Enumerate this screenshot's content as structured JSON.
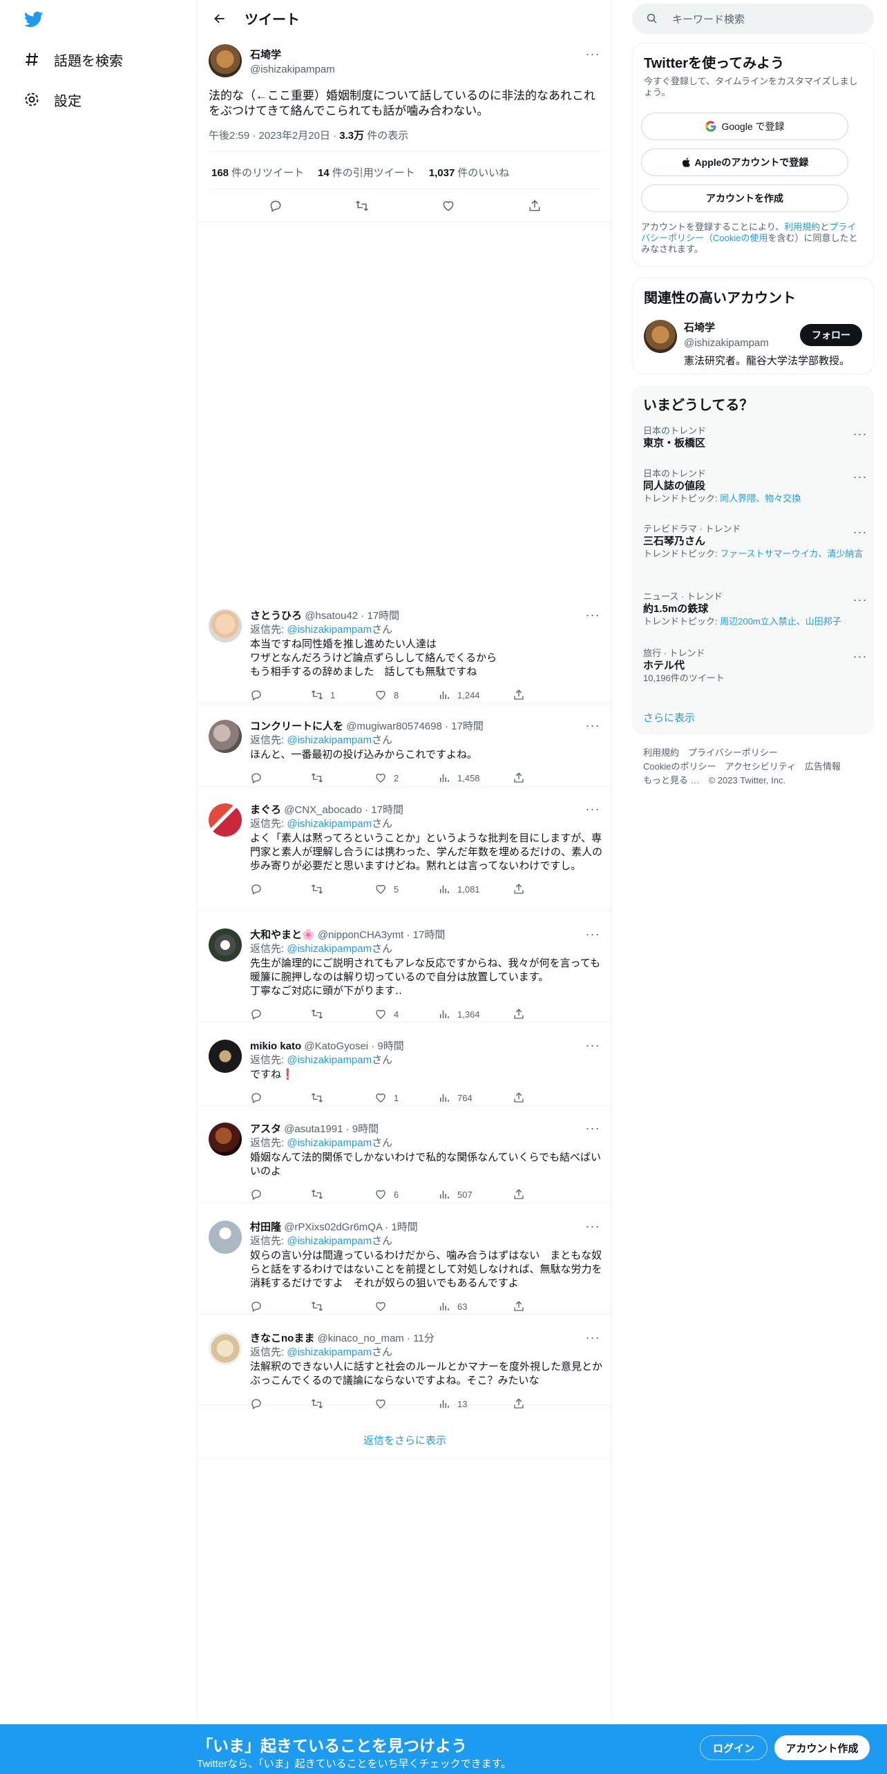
{
  "nav": {
    "logo": "twitter-bird-icon",
    "items": [
      {
        "label": "話題を検索",
        "icon": "hashtag-icon"
      },
      {
        "label": "設定",
        "icon": "gear-icon"
      }
    ]
  },
  "header": {
    "title": "ツイート"
  },
  "main_tweet": {
    "name": "石埼学",
    "handle": "@ishizakipampam",
    "text": "法的な（←ここ重要）婚姻制度について話しているのに非法的なあれこれをぶつけてきて絡んでこられても話が噛み合わない。",
    "time": "午後2:59 · 2023年2月20日 · ",
    "views_count": "3.3万",
    "views_label": " 件の表示",
    "retweets": "168",
    "retweets_label": "件のリツイート",
    "quotes": "14",
    "quotes_label": "件の引用ツイート",
    "likes": "1,037",
    "likes_label": "件のいいね"
  },
  "replying_prefix": "返信先: ",
  "replying_handle": "@ishizakipampam",
  "replying_suffix": "さん",
  "replies": [
    {
      "name": "さとうひろ",
      "meta": "@hsatou42 · 17時間",
      "text": "本当ですね同性婚を推し進めたい人達は\nワザとなんだろうけど論点ずらしして絡んでくるから\nもう相手するの辞めました　話しても無駄ですね",
      "retweets": "1",
      "likes": "8",
      "views": "1,244"
    },
    {
      "name": "コンクリートに人を",
      "meta": "@mugiwar80574698 · 17時間",
      "text": "ほんと、一番最初の投げ込みからこれですよね。",
      "retweets": "",
      "likes": "2",
      "views": "1,458"
    },
    {
      "name": "まぐろ",
      "meta": "@CNX_abocado · 17時間",
      "text": "よく「素人は黙ってろということか」というような批判を目にしますが、専門家と素人が理解し合うには携わった、学んだ年数を埋めるだけの、素人の歩み寄りが必要だと思いますけどね。黙れとは言ってないわけですし。",
      "retweets": "",
      "likes": "5",
      "views": "1,081"
    },
    {
      "name": "大和やまと🌸",
      "meta": "@nipponCHA3ymt · 17時間",
      "text": "先生が論理的にご説明されてもアレな反応ですからね、我々が何を言っても暖簾に腕押しなのは解り切っているので自分は放置しています。\n丁寧なご対応に頭が下がります‥",
      "retweets": "",
      "likes": "4",
      "views": "1,364"
    },
    {
      "name": "mikio kato",
      "meta": "@KatoGyosei · 9時間",
      "text": "ですね❗",
      "retweets": "",
      "likes": "1",
      "views": "764"
    },
    {
      "name": "アスタ",
      "meta": "@asuta1991 · 9時間",
      "text": "婚姻なんて法的関係でしかないわけで私的な関係なんていくらでも結べばいいのよ",
      "retweets": "",
      "likes": "6",
      "views": "507"
    },
    {
      "name": "村田隆",
      "meta": "@rPXixs02dGr6mQA · 1時間",
      "text": "奴らの言い分は間違っているわけだから、噛み合うはずはない　まともな奴らと話をするわけではないことを前提として対処しなければ、無駄な労力を消耗するだけですよ　それが奴らの狙いでもあるんですよ",
      "retweets": "",
      "likes": "",
      "views": "63"
    },
    {
      "name": "きなこnoまま",
      "meta": "@kinaco_no_mam · 11分",
      "text": "法解釈のできない人に話すと社会のルールとかマナーを度外視した意見とかぶっこんでくるので議論にならないですよね。そこ？みたいな",
      "retweets": "",
      "likes": "",
      "views": "13"
    }
  ],
  "show_more_replies": "返信をさらに表示",
  "sidebar": {
    "search_placeholder": "キーワード検索",
    "signup": {
      "title": "Twitterを使ってみよう",
      "subtitle": "今すぐ登録して、タイムラインをカスタマイズしましょう。",
      "google": "Google で登録",
      "apple": "Appleのアカウントで登録",
      "create": "アカウントを作成",
      "legal_1": "アカウントを登録することにより、",
      "legal_link_1": "利用規約",
      "legal_2": "と",
      "legal_link_2": "プライバシーポリシー（Cookieの使用",
      "legal_3": "を含む）に同意したとみなされます。"
    },
    "related": {
      "title": "関連性の高いアカウント",
      "name": "石埼学",
      "handle": "@ishizakipampam",
      "bio": "憲法研究者。龍谷大学法学部教授。",
      "follow": "フォロー"
    },
    "trends": {
      "title": "いまどうしてる？",
      "items": [
        {
          "category": "日本のトレンド",
          "name": "東京・板橋区",
          "sub_prefix": "",
          "sub_link": ""
        },
        {
          "category": "日本のトレンド",
          "name": "同人誌の値段",
          "sub_prefix": "トレンドトピック: ",
          "sub_link": "同人界隈、物々交換"
        },
        {
          "category": "テレビドラマ · トレンド",
          "name": "三石琴乃さん",
          "sub_prefix": "トレンドトピック: ",
          "sub_link": "ファーストサマーウイカ、清少納言"
        },
        {
          "category": "ニュース · トレンド",
          "name": "約1.5mの鉄球",
          "sub_prefix": "トレンドトピック: ",
          "sub_link": "周辺200m立入禁止、山田邦子"
        },
        {
          "category": "旅行 · トレンド",
          "name": "ホテル代",
          "sub_prefix": "10,196件のツイート",
          "sub_link": ""
        }
      ],
      "show_more": "さらに表示"
    },
    "footer": {
      "line1": "利用規約　プライバシーポリシー",
      "line2": "Cookieのポリシー　アクセシビリティ　広告情報",
      "line3": "もっと見る …　© 2023 Twitter, Inc."
    }
  },
  "bottom_bar": {
    "title": "「いま」起きていることを見つけよう",
    "subtitle": "Twitterなら、「いま」起きていることをいち早くチェックできます。",
    "login": "ログイン",
    "signup": "アカウント作成"
  },
  "colors": {
    "accent": "#1d9bf0",
    "text": "#0f1419",
    "secondary": "#536471"
  }
}
